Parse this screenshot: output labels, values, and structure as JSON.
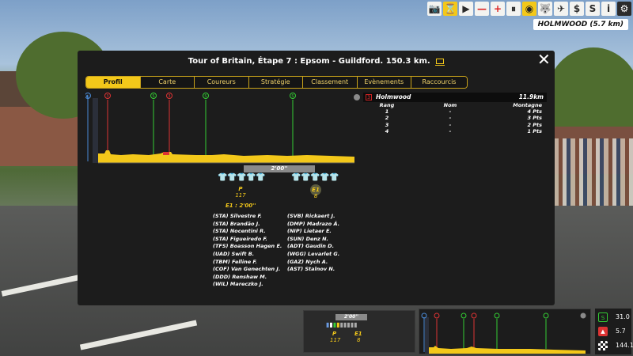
{
  "toolbar": {
    "icons": [
      "camera-icon",
      "hourglass-icon",
      "play-icon",
      "minus-icon",
      "plus-icon",
      "pause-icon",
      "eye-icon",
      "wolf-icon",
      "helicopter-icon",
      "dollar-icon",
      "s-icon",
      "info-icon",
      "gear-icon"
    ],
    "labels": {
      "minus": "—",
      "plus": "+",
      "pause": "⏸",
      "play": "▶",
      "info": "i",
      "gear": "⚙",
      "dollar": "$",
      "s": "S"
    }
  },
  "location_badge": "HOLMWOOD (5.7 km)",
  "modal": {
    "title": "Tour of Britain, Étape 7 : Epsom - Guildford. 150.3 km.",
    "close_label": "✕",
    "tabs": [
      "Profil",
      "Carte",
      "Coureurs",
      "Stratégie",
      "Classement",
      "Evènements",
      "Raccourcis clavier"
    ],
    "active_tab": "Profil"
  },
  "profile": {
    "markers": [
      {
        "label": "◐",
        "type": "start",
        "color": "#4a8ad6"
      },
      {
        "label": "3",
        "type": "climb",
        "color": "#d33"
      },
      {
        "label": "S",
        "type": "sprint",
        "color": "#3c3"
      },
      {
        "label": "3",
        "type": "climb",
        "color": "#d33"
      },
      {
        "label": "S",
        "type": "sprint",
        "color": "#3c3"
      },
      {
        "label": "S",
        "type": "sprint",
        "color": "#3c3"
      }
    ],
    "gap_label": "2'00''",
    "group_p": {
      "label": "P",
      "count": "117"
    },
    "group_e1": {
      "label": "E1",
      "count": "8"
    },
    "e1_time": "E1 : 2'00''",
    "jerseys_p": [
      "blue",
      "white",
      "white",
      "green",
      "yellow"
    ],
    "jerseys_e1": [
      "gray",
      "gray",
      "gray",
      "gray",
      "gray"
    ]
  },
  "riders_left": [
    "(STA) Silvestre F.",
    "(STA) Brandão J.",
    "(STA) Nocentini R.",
    "(STA) Figueiredo F.",
    "(TFS) Boasson Hagen E.",
    "(UAD) Swift B.",
    "(TBM) Felline F.",
    "(COF) Van Genechten J.",
    "(DDD) Renshaw M.",
    "(WIL) Mareczko J."
  ],
  "riders_right": [
    "(SVB) Rickaert J.",
    "(DMP) Madrazo Á.",
    "(NIP) Lietaer E.",
    "(SUN) Denz N.",
    "(ADT) Gaudin D.",
    "(WGG) Levarlet G.",
    "(GAZ) Nych A.",
    "(AST) Stalnov N."
  ],
  "info": {
    "symbol": "3",
    "name": "Holmwood",
    "distance": "11.9km",
    "headers": [
      "Rang",
      "Nom",
      "Montagne"
    ],
    "rows": [
      [
        "1",
        "-",
        "4 Pts"
      ],
      [
        "2",
        "-",
        "3 Pts"
      ],
      [
        "3",
        "-",
        "2 Pts"
      ],
      [
        "4",
        "-",
        "1 Pts"
      ]
    ]
  },
  "mini": {
    "gap_label": "2'00''",
    "p_label": "P",
    "p_count": "117",
    "e1_label": "E1",
    "e1_count": "8"
  },
  "stats": {
    "sprint_value": "31.0",
    "climb_value": "5.7",
    "finish_value": "144.1"
  },
  "colors": {
    "accent": "#f3c81a",
    "panel": "#1c1c1c",
    "sprint": "#3c3",
    "climb": "#d33"
  }
}
